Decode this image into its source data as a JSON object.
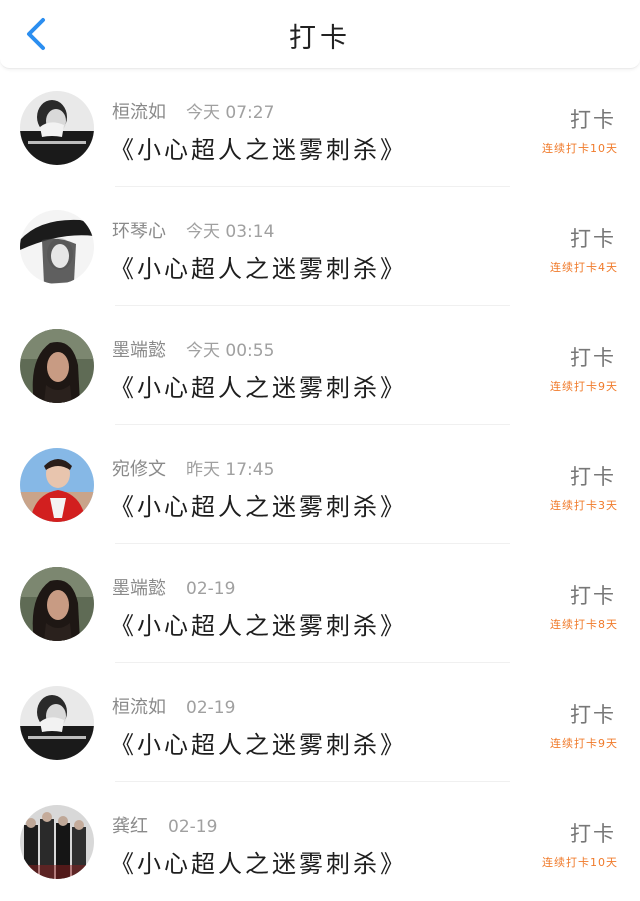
{
  "header": {
    "title": "打卡",
    "back_icon": "chevron-left-icon",
    "accent": "#2b8ef0"
  },
  "rows": [
    {
      "name": "桓流如",
      "time": "今天 07:27",
      "book": "《小心超人之迷雾刺杀》",
      "action": "打卡",
      "streak": "连续打卡10天",
      "avatar": "bw-hand-face"
    },
    {
      "name": "环琴心",
      "time": "今天 03:14",
      "book": "《小心超人之迷雾刺杀》",
      "action": "打卡",
      "streak": "连续打卡4天",
      "avatar": "bw-hat-girl"
    },
    {
      "name": "墨端懿",
      "time": "今天 00:55",
      "book": "《小心超人之迷雾刺杀》",
      "action": "打卡",
      "streak": "连续打卡9天",
      "avatar": "dark-hair-girl"
    },
    {
      "name": "宛修文",
      "time": "昨天 17:45",
      "book": "《小心超人之迷雾刺杀》",
      "action": "打卡",
      "streak": "连续打卡3天",
      "avatar": "red-outfit-boy"
    },
    {
      "name": "墨端懿",
      "time": "02-19",
      "book": "《小心超人之迷雾刺杀》",
      "action": "打卡",
      "streak": "连续打卡8天",
      "avatar": "dark-hair-girl"
    },
    {
      "name": "桓流如",
      "time": "02-19",
      "book": "《小心超人之迷雾刺杀》",
      "action": "打卡",
      "streak": "连续打卡9天",
      "avatar": "bw-hand-face"
    },
    {
      "name": "龚红",
      "time": "02-19",
      "book": "《小心超人之迷雾刺杀》",
      "action": "打卡",
      "streak": "连续打卡10天",
      "avatar": "band-group"
    }
  ],
  "colors": {
    "streak": "#f07a2a",
    "name": "#8a8a8a",
    "book": "#1e1e1e"
  }
}
